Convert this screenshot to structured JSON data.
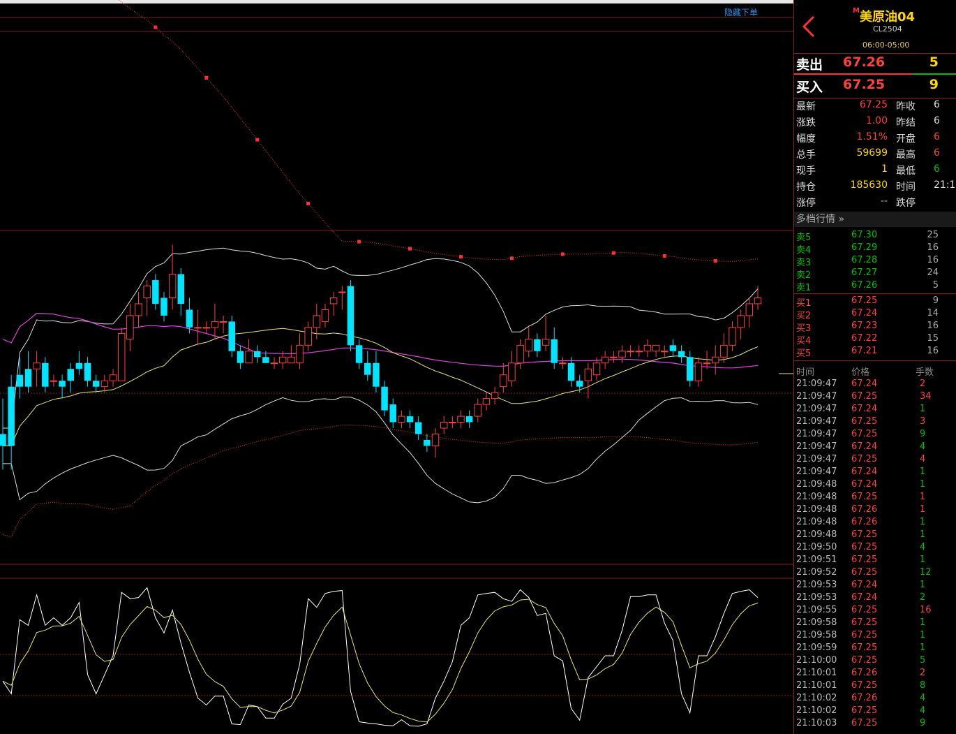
{
  "chart_toolbar": {
    "hide_orders_label": "隐藏下单"
  },
  "colors": {
    "up": "#ff4040",
    "down": "#00e5ff",
    "ma_long": "#e040e0",
    "ma_short": "#e8e860",
    "boll": "#dddddd",
    "sar": "#ff3030",
    "grid": "#8b1a1a"
  },
  "quote": {
    "market_badge": "M",
    "name": "美原油04",
    "code": "CL2504",
    "session": "06:00-05:00",
    "ask": {
      "label": "卖出",
      "price": "67.26",
      "volume": "5"
    },
    "bid": {
      "label": "买入",
      "price": "67.25",
      "volume": "9"
    },
    "stats": [
      {
        "label": "最新",
        "value": "67.25",
        "label2": "昨收",
        "value2": "6"
      },
      {
        "label": "涨跌",
        "value": "1.00",
        "label2": "昨结",
        "value2": "6"
      },
      {
        "label": "幅度",
        "value": "1.51%",
        "label2": "开盘",
        "value2": "6"
      },
      {
        "label": "总手",
        "value": "59699",
        "label2": "最高",
        "value2": "6"
      },
      {
        "label": "现手",
        "value": "1",
        "label2": "最低",
        "value2": "6"
      },
      {
        "label": "持仓",
        "value": "185630",
        "label2": "时间",
        "value2": "21:1"
      },
      {
        "label": "涨停",
        "value": "--",
        "label2": "跌停",
        "value2": ""
      }
    ]
  },
  "depth": {
    "header": "多档行情",
    "asks": [
      {
        "label": "卖5",
        "price": "67.30",
        "qty": "25"
      },
      {
        "label": "卖4",
        "price": "67.29",
        "qty": "16"
      },
      {
        "label": "卖3",
        "price": "67.28",
        "qty": "16"
      },
      {
        "label": "卖2",
        "price": "67.27",
        "qty": "24"
      },
      {
        "label": "卖1",
        "price": "67.26",
        "qty": "5"
      }
    ],
    "bids": [
      {
        "label": "买1",
        "price": "67.25",
        "qty": "9"
      },
      {
        "label": "买2",
        "price": "67.24",
        "qty": "14"
      },
      {
        "label": "买3",
        "price": "67.23",
        "qty": "16"
      },
      {
        "label": "买4",
        "price": "67.22",
        "qty": "15"
      },
      {
        "label": "买5",
        "price": "67.21",
        "qty": "16"
      }
    ]
  },
  "ticks": {
    "headers": [
      "时间",
      "价格",
      "手数"
    ],
    "rows": [
      [
        "21:09:47",
        "67.24",
        "2",
        "r"
      ],
      [
        "21:09:47",
        "67.25",
        "34",
        "r"
      ],
      [
        "21:09:47",
        "67.24",
        "1",
        "g"
      ],
      [
        "21:09:47",
        "67.25",
        "3",
        "r"
      ],
      [
        "21:09:47",
        "67.25",
        "9",
        "g"
      ],
      [
        "21:09:47",
        "67.24",
        "4",
        "g"
      ],
      [
        "21:09:47",
        "67.25",
        "4",
        "r"
      ],
      [
        "21:09:47",
        "67.24",
        "1",
        "g"
      ],
      [
        "21:09:48",
        "67.24",
        "1",
        "g"
      ],
      [
        "21:09:48",
        "67.25",
        "1",
        "r"
      ],
      [
        "21:09:48",
        "67.26",
        "1",
        "r"
      ],
      [
        "21:09:48",
        "67.26",
        "1",
        "g"
      ],
      [
        "21:09:48",
        "67.25",
        "1",
        "g"
      ],
      [
        "21:09:50",
        "67.25",
        "4",
        "g"
      ],
      [
        "21:09:51",
        "67.25",
        "1",
        "g"
      ],
      [
        "21:09:52",
        "67.25",
        "12",
        "g"
      ],
      [
        "21:09:53",
        "67.24",
        "1",
        "g"
      ],
      [
        "21:09:53",
        "67.24",
        "2",
        "g"
      ],
      [
        "21:09:55",
        "67.25",
        "16",
        "r"
      ],
      [
        "21:09:58",
        "67.25",
        "1",
        "g"
      ],
      [
        "21:09:58",
        "67.25",
        "1",
        "g"
      ],
      [
        "21:09:59",
        "67.25",
        "1",
        "g"
      ],
      [
        "21:10:00",
        "67.25",
        "5",
        "g"
      ],
      [
        "21:10:01",
        "67.26",
        "2",
        "r"
      ],
      [
        "21:10:01",
        "67.25",
        "8",
        "g"
      ],
      [
        "21:10:02",
        "67.26",
        "4",
        "g"
      ],
      [
        "21:10:02",
        "67.25",
        "4",
        "g"
      ],
      [
        "21:10:03",
        "67.25",
        "9",
        "g"
      ]
    ]
  },
  "chart_data": {
    "type": "candlestick",
    "candles": [
      [
        66.72,
        66.7,
        66.78,
        66.66
      ],
      [
        66.8,
        66.7,
        66.82,
        66.66
      ],
      [
        66.82,
        66.8,
        66.85,
        66.78
      ],
      [
        66.83,
        66.8,
        66.86,
        66.79
      ],
      [
        66.83,
        66.84,
        66.86,
        66.8
      ],
      [
        66.84,
        66.8,
        66.85,
        66.79
      ],
      [
        66.81,
        66.81,
        66.82,
        66.8
      ],
      [
        66.81,
        66.8,
        66.82,
        66.78
      ],
      [
        66.83,
        66.81,
        66.84,
        66.79
      ],
      [
        66.84,
        66.83,
        66.86,
        66.82
      ],
      [
        66.84,
        66.81,
        66.85,
        66.8
      ],
      [
        66.81,
        66.8,
        66.82,
        66.79
      ],
      [
        66.8,
        66.81,
        66.82,
        66.79
      ],
      [
        66.81,
        66.82,
        66.83,
        66.8
      ],
      [
        66.81,
        66.89,
        66.9,
        66.81
      ],
      [
        66.88,
        66.92,
        66.94,
        66.86
      ],
      [
        66.92,
        66.94,
        66.96,
        66.9
      ],
      [
        66.95,
        66.97,
        66.98,
        66.92
      ],
      [
        66.98,
        66.94,
        66.99,
        66.93
      ],
      [
        66.95,
        66.92,
        66.96,
        66.91
      ],
      [
        66.95,
        66.99,
        67.04,
        66.93
      ],
      [
        66.99,
        66.94,
        67.0,
        66.92
      ],
      [
        66.93,
        66.9,
        66.95,
        66.89
      ],
      [
        66.9,
        66.9,
        66.93,
        66.87
      ],
      [
        66.9,
        66.9,
        66.91,
        66.89
      ],
      [
        66.9,
        66.91,
        66.94,
        66.88
      ],
      [
        66.91,
        66.91,
        66.92,
        66.89
      ],
      [
        66.91,
        66.86,
        66.92,
        66.85
      ],
      [
        66.86,
        66.84,
        66.87,
        66.83
      ],
      [
        66.84,
        66.86,
        66.88,
        66.84
      ],
      [
        66.86,
        66.85,
        66.87,
        66.84
      ],
      [
        66.85,
        66.84,
        66.86,
        66.84
      ],
      [
        66.84,
        66.84,
        66.85,
        66.83
      ],
      [
        66.84,
        66.85,
        66.86,
        66.83
      ],
      [
        66.84,
        66.85,
        66.87,
        66.84
      ],
      [
        66.84,
        66.87,
        66.89,
        66.83
      ],
      [
        66.87,
        66.9,
        66.91,
        66.86
      ],
      [
        66.9,
        66.92,
        66.94,
        66.88
      ],
      [
        66.91,
        66.93,
        66.94,
        66.9
      ],
      [
        66.94,
        66.95,
        66.96,
        66.92
      ],
      [
        66.96,
        66.96,
        66.97,
        66.93
      ],
      [
        66.97,
        66.87,
        66.98,
        66.86
      ],
      [
        66.87,
        66.84,
        66.88,
        66.83
      ],
      [
        66.84,
        66.82,
        66.86,
        66.81
      ],
      [
        66.84,
        66.8,
        66.86,
        66.79
      ],
      [
        66.8,
        66.76,
        66.81,
        66.75
      ],
      [
        66.77,
        66.74,
        66.78,
        66.73
      ],
      [
        66.74,
        66.75,
        66.76,
        66.73
      ],
      [
        66.75,
        66.74,
        66.76,
        66.73
      ],
      [
        66.74,
        66.72,
        66.75,
        66.71
      ],
      [
        66.71,
        66.7,
        66.72,
        66.69
      ],
      [
        66.7,
        66.72,
        66.73,
        66.68
      ],
      [
        66.73,
        66.74,
        66.75,
        66.72
      ],
      [
        66.74,
        66.74,
        66.75,
        66.73
      ],
      [
        66.74,
        66.75,
        66.76,
        66.73
      ],
      [
        66.75,
        66.74,
        66.76,
        66.73
      ],
      [
        66.75,
        66.77,
        66.78,
        66.74
      ],
      [
        66.77,
        66.78,
        66.79,
        66.76
      ],
      [
        66.78,
        66.79,
        66.8,
        66.77
      ],
      [
        66.8,
        66.82,
        66.84,
        66.79
      ],
      [
        66.81,
        66.84,
        66.86,
        66.8
      ],
      [
        66.84,
        66.87,
        66.88,
        66.83
      ],
      [
        66.86,
        66.88,
        66.9,
        66.85
      ],
      [
        66.88,
        66.86,
        66.89,
        66.85
      ],
      [
        66.87,
        66.88,
        66.92,
        66.86
      ],
      [
        66.88,
        66.84,
        66.9,
        66.83
      ],
      [
        66.84,
        66.84,
        66.85,
        66.83
      ],
      [
        66.84,
        66.81,
        66.85,
        66.8
      ],
      [
        66.81,
        66.8,
        66.82,
        66.79
      ],
      [
        66.81,
        66.83,
        66.84,
        66.78
      ],
      [
        66.82,
        66.84,
        66.85,
        66.81
      ],
      [
        66.84,
        66.85,
        66.86,
        66.83
      ],
      [
        66.85,
        66.85,
        66.86,
        66.84
      ],
      [
        66.85,
        66.86,
        66.87,
        66.84
      ],
      [
        66.86,
        66.86,
        66.87,
        66.85
      ],
      [
        66.86,
        66.86,
        66.87,
        66.85
      ],
      [
        66.86,
        66.87,
        66.88,
        66.85
      ],
      [
        66.86,
        66.87,
        66.87,
        66.85
      ],
      [
        66.86,
        66.86,
        66.87,
        66.85
      ],
      [
        66.87,
        66.86,
        66.88,
        66.85
      ],
      [
        66.86,
        66.85,
        66.87,
        66.84
      ],
      [
        66.85,
        66.81,
        66.86,
        66.8
      ],
      [
        66.81,
        66.84,
        66.85,
        66.8
      ],
      [
        66.84,
        66.84,
        66.86,
        66.83
      ],
      [
        66.84,
        66.85,
        66.87,
        66.82
      ],
      [
        66.85,
        66.87,
        66.89,
        66.84
      ],
      [
        66.87,
        66.9,
        66.91,
        66.86
      ],
      [
        66.9,
        66.92,
        66.93,
        66.88
      ],
      [
        66.92,
        66.94,
        66.95,
        66.9
      ],
      [
        66.94,
        66.95,
        66.97,
        66.93
      ]
    ]
  }
}
